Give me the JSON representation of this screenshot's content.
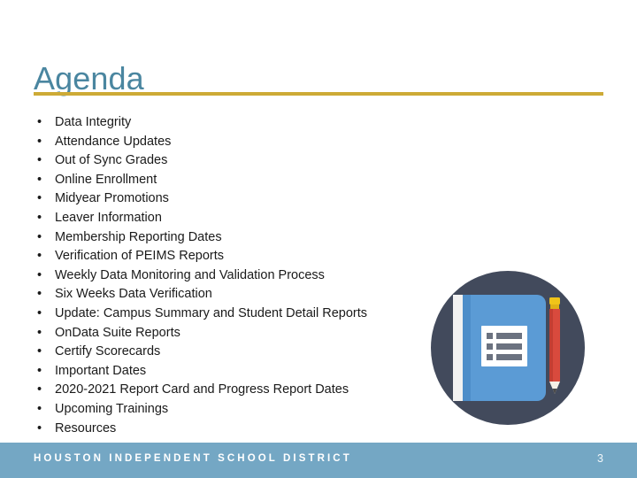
{
  "slide": {
    "title": "Agenda",
    "accent_color": "#4a86a0",
    "divider_color": "#cdaa36",
    "background_color": "#ffffff"
  },
  "bullets": [
    {
      "marker": "•",
      "text": "Data Integrity"
    },
    {
      "marker": "•",
      "text": "Attendance Updates"
    },
    {
      "marker": "•",
      "text": "Out of Sync Grades"
    },
    {
      "marker": "•",
      "text": "Online Enrollment"
    },
    {
      "marker": "•",
      "text": "Midyear Promotions"
    },
    {
      "marker": "•",
      "text": "Leaver Information"
    },
    {
      "marker": "•",
      "text": "Membership Reporting Dates"
    },
    {
      "marker": "•",
      "text": "Verification of PEIMS Reports"
    },
    {
      "marker": "•",
      "text": "Weekly Data Monitoring and Validation Process"
    },
    {
      "marker": "•",
      "text": "Six Weeks Data Verification"
    },
    {
      "marker": "•",
      "text": "Update: Campus Summary and Student Detail Reports"
    },
    {
      "marker": "•",
      "text": "OnData Suite Reports"
    },
    {
      "marker": "•",
      "text": "Certify Scorecards"
    },
    {
      "marker": "•",
      "text": "Important Dates"
    },
    {
      "marker": "•",
      "text": "2020-2021 Report Card and Progress Report Dates"
    },
    {
      "marker": "•",
      "text": "Upcoming Trainings"
    },
    {
      "marker": "•",
      "text": "Resources"
    }
  ],
  "illustration": {
    "name": "notebook-and-pencil-icon",
    "circle_color": "#424a5c",
    "book_cover_color": "#5b9bd5",
    "book_spine_color": "#4a8ac4",
    "page_edge_color": "#f2f2f2",
    "list_icon_color": "#ffffff",
    "list_line_color": "#6b7280",
    "pencil_body_color": "#d94a3d",
    "pencil_eraser_color": "#f0c419",
    "pencil_tip_color": "#f5f0e6"
  },
  "footer": {
    "organization": "HOUSTON INDEPENDENT SCHOOL DISTRICT",
    "page_number": "3",
    "background_color": "#74a7c4",
    "text_color": "#ffffff"
  }
}
